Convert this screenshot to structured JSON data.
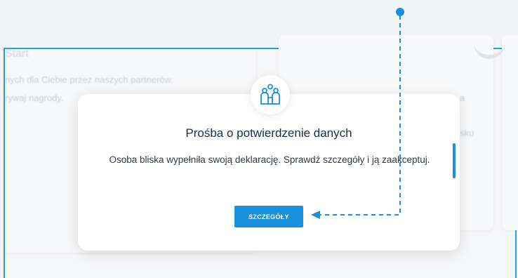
{
  "background": {
    "card1": {
      "title": "Start",
      "line1": "nych dla Ciebie przez naszych partnerów.",
      "line2": "rywaj nagrody."
    },
    "card2": {
      "line1": "a",
      "line2": "sku"
    }
  },
  "modal": {
    "icon": "family-icon",
    "title": "Prośba o potwierdzenie danych",
    "body": "Osoba bliska wypełniła swoją deklarację. Sprawdź szczegóły i ją zaakceptuj.",
    "button_label": "SZCZEGÓŁY"
  },
  "colors": {
    "accent": "#1a8fdb",
    "frame": "#1fa3dc",
    "title": "#1d2b45"
  }
}
